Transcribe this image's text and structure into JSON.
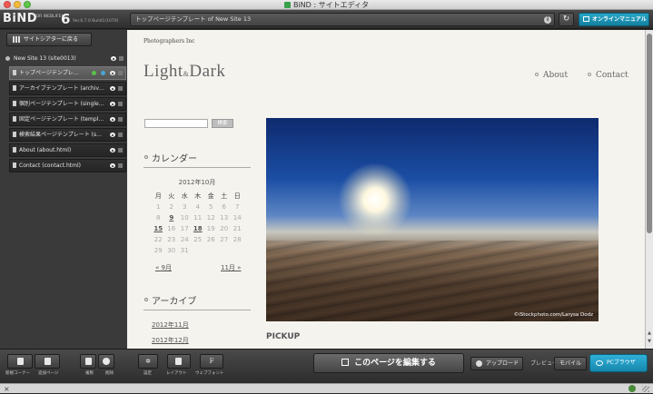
{
  "window": {
    "title": "BiND : サイトエディタ"
  },
  "toolbar": {
    "logo_main": "BiND",
    "logo_sub": "FOR WEBLIFE*",
    "logo_version_num": "6",
    "logo_build": "Ver.6.7.0 Build1(1070)",
    "url_text": "トップページテンプレート of New Site 13",
    "manual_label": "オンラインマニュアル"
  },
  "sidebar": {
    "back_label": "サイトシアターに戻る",
    "site_label": "New Site 13 (site0013)",
    "pages": [
      {
        "label": "トップページテンプレ…",
        "active": true
      },
      {
        "label": "アーカイブテンプレート (archiv…",
        "active": false
      },
      {
        "label": "個別ページテンプレート (single…",
        "active": false
      },
      {
        "label": "固定ページテンプレート (templ…",
        "active": false
      },
      {
        "label": "検索結果ページテンプレート (s…",
        "active": false
      },
      {
        "label": "About (about.html)",
        "active": false
      },
      {
        "label": "Contact (contact.html)",
        "active": false
      }
    ]
  },
  "page": {
    "company": "Photographers Inc",
    "title_left": "Light",
    "title_amp": "&",
    "title_right": "Dark",
    "nav": [
      "About",
      "Contact"
    ],
    "search_button": "検索",
    "calendar_heading": "カレンダー",
    "calendar_month": "2012年10月",
    "calendar_days": [
      "月",
      "火",
      "水",
      "木",
      "金",
      "土",
      "日"
    ],
    "calendar_weeks": [
      [
        "1",
        "2",
        "3",
        "4",
        "5",
        "6",
        "7"
      ],
      [
        "8",
        "9",
        "10",
        "11",
        "12",
        "13",
        "14"
      ],
      [
        "15",
        "16",
        "17",
        "18",
        "19",
        "20",
        "21"
      ],
      [
        "22",
        "23",
        "24",
        "25",
        "26",
        "27",
        "28"
      ],
      [
        "29",
        "30",
        "31",
        "",
        "",
        "",
        ""
      ]
    ],
    "calendar_links": [
      "9",
      "15",
      "18"
    ],
    "cal_prev": "« 9月",
    "cal_next": "11月 »",
    "archive_heading": "アーカイブ",
    "archives": [
      "2012年11月",
      "2012年12月"
    ],
    "photo_credit": "©iStockphoto.com/Larysa Dodz",
    "pickup_heading": "PICKUP"
  },
  "bottombar": {
    "group1_label": "新規コーナー",
    "group2_label": "追加ページ",
    "group3a_label": "複製",
    "group3b_label": "削除",
    "settings_label": "設定",
    "layout_label": "レイアウト",
    "webfont_label": "ウェブフォント",
    "webfont_glyph": "F",
    "edit_page_label": "このページを編集する",
    "upload_label": "アップロード",
    "preview_label": "プレビュー",
    "mobile_label": "モバイル",
    "pc_browser_label": "PCブラウザ"
  },
  "status": {
    "close_glyph": "×"
  }
}
